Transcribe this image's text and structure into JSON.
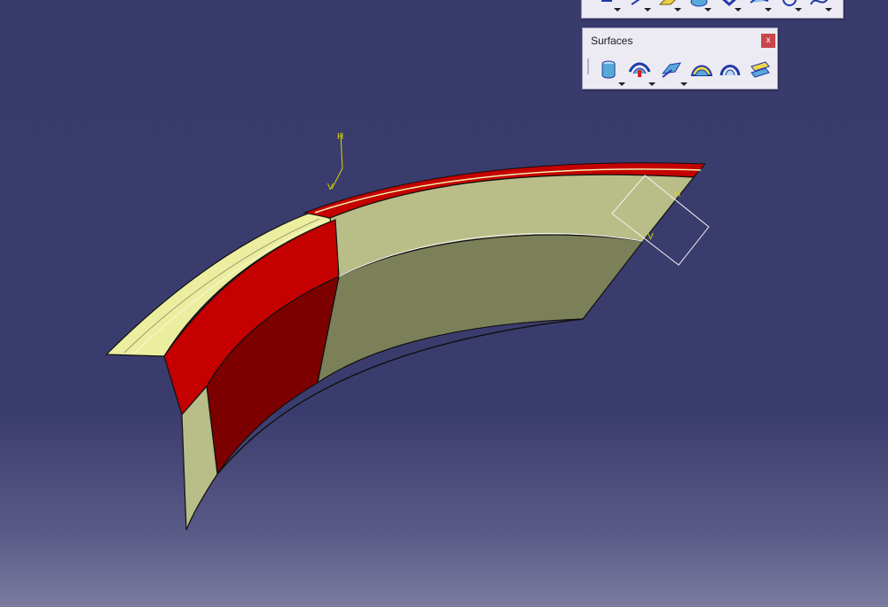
{
  "top_toolbar": {
    "icons": [
      "point-icon",
      "line-icon",
      "plane-icon",
      "projection-icon",
      "intersection-icon",
      "parallel-curve-icon",
      "circle-icon",
      "spline-icon"
    ]
  },
  "surfaces_toolbar": {
    "title": "Surfaces",
    "close_label": "x",
    "icons": [
      "extrude-icon",
      "offset-icon",
      "sweep-icon",
      "fill-icon",
      "loft-icon",
      "blend-icon"
    ]
  },
  "colors": {
    "background_top": "#3a3b6d",
    "surface_light": "#b9be88",
    "surface_dark": "#7b8058",
    "flange": "#ecee9f",
    "red_face": "#c40000",
    "dark_red_face": "#7c0000"
  }
}
